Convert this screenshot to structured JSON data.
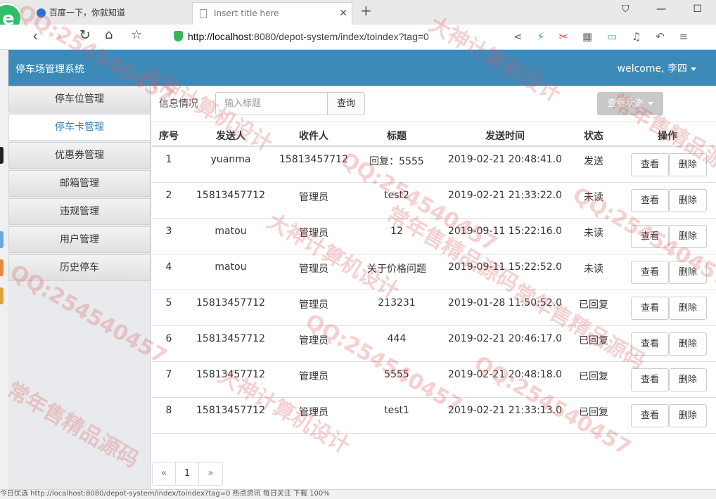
{
  "browser": {
    "tabs": [
      {
        "title": "百度一下，你就知道"
      },
      {
        "title": "Insert title here"
      }
    ],
    "url_host": "http://localhost",
    "url_rest": ":8080/depot-system/index/toindex?tag=0",
    "status_text": "今日优选   http://localhost:8080/depot-system/index/toindex?tag=0   热点资讯   每日关注   下载   100%"
  },
  "app": {
    "title": "停车场管理系统",
    "welcome": "welcome, 李四"
  },
  "sidebar": {
    "items": [
      {
        "label": "停车位管理"
      },
      {
        "label": "停车卡管理"
      },
      {
        "label": "优惠券管理"
      },
      {
        "label": "邮箱管理"
      },
      {
        "label": "违规管理"
      },
      {
        "label": "用户管理"
      },
      {
        "label": "历史停车"
      }
    ]
  },
  "toolbar": {
    "label": "信息情况",
    "search_placeholder": "输入标题",
    "search_button": "查询",
    "status_button": "查看状态"
  },
  "table": {
    "columns": [
      "序号",
      "发送人",
      "收件人",
      "标题",
      "发送时间",
      "状态",
      "操作"
    ],
    "rows": [
      {
        "no": "1",
        "from": "yuanma",
        "to": "15813457712",
        "title": "回复：5555",
        "time": "2019-02-21 20:48:41.0",
        "state": "发送"
      },
      {
        "no": "2",
        "from": "15813457712",
        "to": "管理员",
        "title": "test2",
        "time": "2019-02-21 21:33:22.0",
        "state": "未读"
      },
      {
        "no": "3",
        "from": "matou",
        "to": "管理员",
        "title": "12",
        "time": "2019-09-11 15:22:16.0",
        "state": "未读"
      },
      {
        "no": "4",
        "from": "matou",
        "to": "管理员",
        "title": "关于价格问题",
        "time": "2019-09-11 15:22:52.0",
        "state": "未读"
      },
      {
        "no": "5",
        "from": "15813457712",
        "to": "管理员",
        "title": "213231",
        "time": "2019-01-28 11:50:52.0",
        "state": "已回复"
      },
      {
        "no": "6",
        "from": "15813457712",
        "to": "管理员",
        "title": "444",
        "time": "2019-02-21 20:46:17.0",
        "state": "已回复"
      },
      {
        "no": "7",
        "from": "15813457712",
        "to": "管理员",
        "title": "5555",
        "time": "2019-02-21 20:48:18.0",
        "state": "已回复"
      },
      {
        "no": "8",
        "from": "15813457712",
        "to": "管理员",
        "title": "test1",
        "time": "2019-02-21 21:33:13.0",
        "state": "已回复"
      }
    ],
    "view_label": "查看",
    "delete_label": "删除"
  },
  "pager": {
    "prev": "«",
    "page": "1",
    "next": "»"
  },
  "watermarks": [
    "QQ:254540457",
    "大神计算机设计",
    "常年售精品源码"
  ],
  "colors": {
    "header_bg": "#3d8ab9",
    "active_nav": "#2d7fb8",
    "watermark": "#dc5a5a"
  }
}
